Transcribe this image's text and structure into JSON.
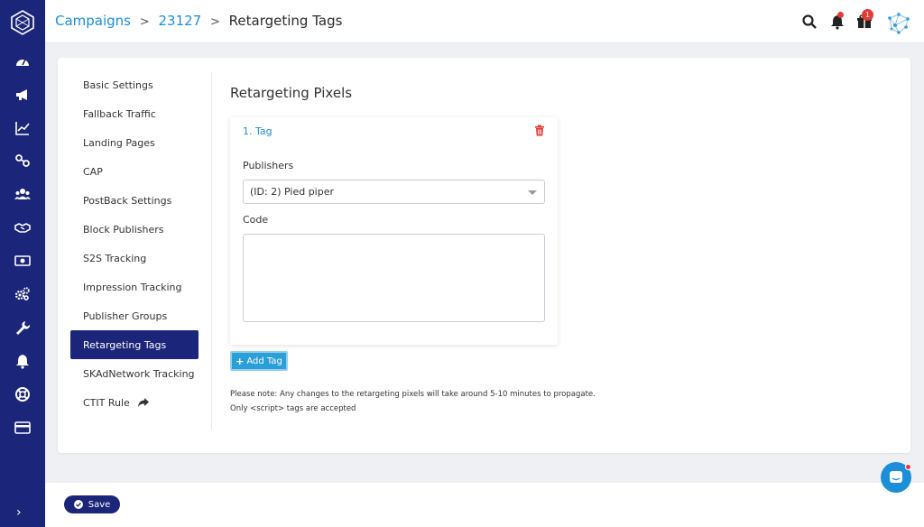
{
  "colors": {
    "rail": "#1b2579",
    "accent": "#1d8ed8",
    "active_menu": "#1b2579",
    "add_button": "#2a9fd8",
    "danger": "#e53935"
  },
  "breadcrumb": {
    "campaigns": "Campaigns",
    "separator": ">",
    "campaign_id": "23127",
    "current": "Retargeting Tags"
  },
  "topbar": {
    "gift_badge_count": "1",
    "icons": [
      "search-icon",
      "bell-icon",
      "gift-icon",
      "avatar"
    ]
  },
  "rail_icons": [
    "dashboard-icon",
    "megaphone-icon",
    "chart-line-icon",
    "link-icon",
    "users-icon",
    "handshake-icon",
    "money-icon",
    "gears-icon",
    "wrench-icon",
    "bell-icon",
    "support-icon",
    "credit-card-icon"
  ],
  "rail_expand": "›",
  "menu": {
    "items": [
      {
        "label": "Basic Settings"
      },
      {
        "label": "Fallback Traffic"
      },
      {
        "label": "Landing Pages"
      },
      {
        "label": "CAP"
      },
      {
        "label": "PostBack Settings"
      },
      {
        "label": "Block Publishers"
      },
      {
        "label": "S2S Tracking"
      },
      {
        "label": "Impression Tracking"
      },
      {
        "label": "Publisher Groups"
      },
      {
        "label": "Retargeting Tags"
      },
      {
        "label": "SKAdNetwork Tracking"
      },
      {
        "label": "CTIT Rule"
      }
    ],
    "active_index": 9
  },
  "main": {
    "heading": "Retargeting Pixels",
    "tag": {
      "title": "1. Tag",
      "publishers_label": "Publishers",
      "publishers_value": "(ID: 2) Pied piper",
      "code_label": "Code",
      "code_value": ""
    },
    "add_tag_label": "Add Tag",
    "note_line1": "Please note: Any changes to the retargeting pixels will take around 5-10 minutes to propagate.",
    "note_line2": "Only <script> tags are accepted"
  },
  "footer": {
    "save_label": "Save"
  }
}
